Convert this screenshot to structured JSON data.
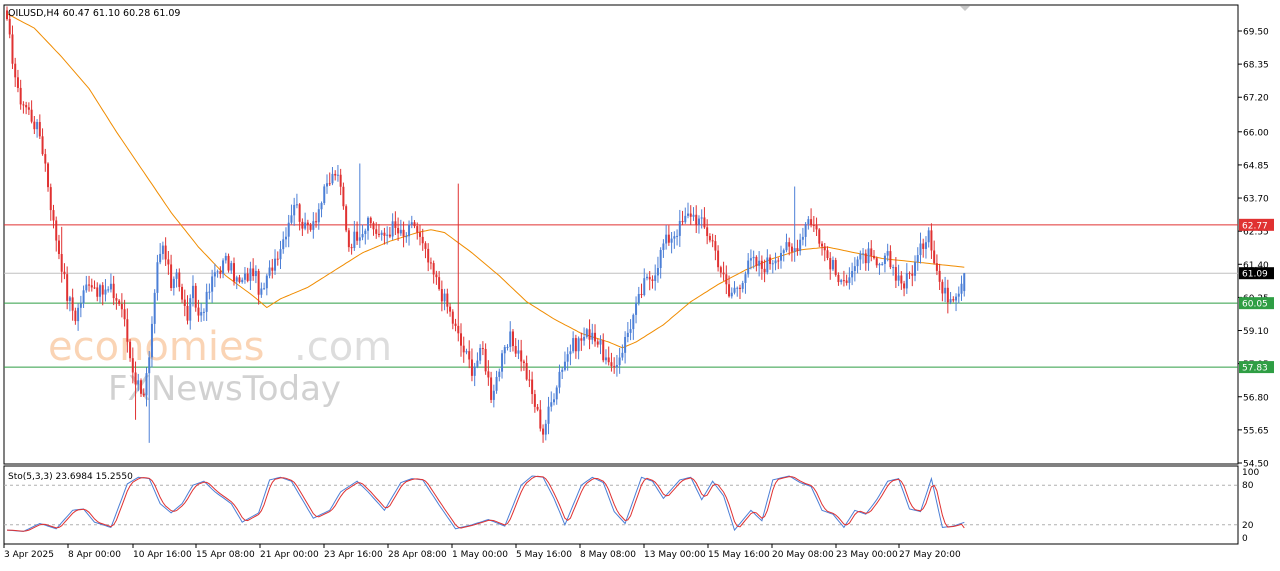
{
  "window": {
    "header_text": "OILUSD,H4  60.47 61.10 60.28 61.09"
  },
  "chart_data": {
    "type": "candlestick",
    "symbol": "OILUSD",
    "timeframe": "H4",
    "ohlc_header": {
      "open": 60.47,
      "high": 61.1,
      "low": 60.28,
      "close": 61.09
    },
    "ylim": [
      54.5,
      70.4
    ],
    "price_ticks": [
      "69.50",
      "68.35",
      "67.20",
      "66.00",
      "64.85",
      "63.70",
      "62.55",
      "61.40",
      "60.25",
      "59.10",
      "57.95",
      "56.80",
      "55.65",
      "54.50"
    ],
    "x_ticks": [
      "3 Apr 2025",
      "8 Apr 00:00",
      "10 Apr 16:00",
      "15 Apr 08:00",
      "21 Apr 00:00",
      "23 Apr 16:00",
      "28 Apr 08:00",
      "1 May 00:00",
      "5 May 16:00",
      "8 May 08:00",
      "13 May 00:00",
      "15 May 16:00",
      "20 May 08:00",
      "23 May 00:00",
      "27 May 20:00"
    ],
    "horizontal_levels": [
      {
        "label": "62.77",
        "value": 62.77,
        "color": "#e03131"
      },
      {
        "label": "60.05",
        "value": 60.05,
        "color": "#2f9e44"
      },
      {
        "label": "57.83",
        "value": 57.83,
        "color": "#2f9e44"
      }
    ],
    "current_price": {
      "label": "61.09",
      "value": 61.09
    },
    "ma_color": "#f08c00",
    "bull_color": "#4c7fd6",
    "bear_color": "#e03131",
    "close_anchors": [
      [
        0,
        69.7
      ],
      [
        2,
        68.6
      ],
      [
        4,
        67.3
      ],
      [
        8,
        66.7
      ],
      [
        12,
        65.9
      ],
      [
        14,
        64.9
      ],
      [
        17,
        62.8
      ],
      [
        20,
        61.4
      ],
      [
        22,
        60.3
      ],
      [
        25,
        59.6
      ],
      [
        30,
        60.9
      ],
      [
        34,
        60.4
      ],
      [
        38,
        60.5
      ],
      [
        42,
        59.9
      ],
      [
        45,
        58.2
      ],
      [
        47,
        57.4
      ],
      [
        50,
        57.0
      ],
      [
        52,
        58.0
      ],
      [
        55,
        61.3
      ],
      [
        57,
        62.0
      ],
      [
        60,
        60.7
      ],
      [
        62,
        61.3
      ],
      [
        64,
        60.1
      ],
      [
        66,
        59.6
      ],
      [
        68,
        60.4
      ],
      [
        70,
        59.6
      ],
      [
        73,
        60.2
      ],
      [
        76,
        61.1
      ],
      [
        80,
        61.5
      ],
      [
        85,
        60.7
      ],
      [
        90,
        61.2
      ],
      [
        93,
        60.3
      ],
      [
        97,
        61.4
      ],
      [
        101,
        62.3
      ],
      [
        105,
        63.6
      ],
      [
        109,
        62.6
      ],
      [
        113,
        63.1
      ],
      [
        117,
        64.1
      ],
      [
        120,
        64.6
      ],
      [
        122,
        64.0
      ],
      [
        125,
        62.1
      ],
      [
        129,
        62.6
      ],
      [
        133,
        62.8
      ],
      [
        137,
        62.3
      ],
      [
        141,
        62.7
      ],
      [
        145,
        62.3
      ],
      [
        149,
        62.8
      ],
      [
        152,
        62.0
      ],
      [
        155,
        61.2
      ],
      [
        158,
        60.6
      ],
      [
        162,
        59.7
      ],
      [
        166,
        58.6
      ],
      [
        170,
        57.8
      ],
      [
        174,
        58.4
      ],
      [
        177,
        56.9
      ],
      [
        180,
        57.8
      ],
      [
        184,
        58.8
      ],
      [
        188,
        58.2
      ],
      [
        191,
        57.2
      ],
      [
        194,
        56.2
      ],
      [
        196,
        55.6
      ],
      [
        199,
        56.6
      ],
      [
        202,
        57.7
      ],
      [
        206,
        58.5
      ],
      [
        210,
        58.8
      ],
      [
        214,
        59.1
      ],
      [
        218,
        58.3
      ],
      [
        221,
        57.6
      ],
      [
        225,
        58.5
      ],
      [
        229,
        59.6
      ],
      [
        233,
        60.7
      ],
      [
        237,
        61.2
      ],
      [
        240,
        62.1
      ],
      [
        244,
        62.5
      ],
      [
        246,
        62.7
      ],
      [
        250,
        63.2
      ],
      [
        254,
        62.8
      ],
      [
        258,
        62.2
      ],
      [
        261,
        61.2
      ],
      [
        264,
        60.3
      ],
      [
        268,
        60.8
      ],
      [
        272,
        61.5
      ],
      [
        276,
        61.3
      ],
      [
        280,
        61.6
      ],
      [
        284,
        62.0
      ],
      [
        287,
        61.8
      ],
      [
        290,
        62.3
      ],
      [
        293,
        63.1
      ],
      [
        296,
        62.6
      ],
      [
        298,
        62.0
      ],
      [
        302,
        61.3
      ],
      [
        305,
        60.6
      ],
      [
        308,
        61.2
      ],
      [
        311,
        61.5
      ],
      [
        315,
        61.7
      ],
      [
        318,
        61.2
      ],
      [
        322,
        61.6
      ],
      [
        325,
        61.1
      ],
      [
        328,
        60.7
      ],
      [
        332,
        61.4
      ],
      [
        335,
        62.1
      ],
      [
        337,
        62.7
      ],
      [
        339,
        61.6
      ],
      [
        342,
        60.4
      ],
      [
        345,
        60.3
      ],
      [
        348,
        60.6
      ],
      [
        350,
        61.09
      ]
    ],
    "ma_points": [
      [
        0,
        70.1
      ],
      [
        10,
        69.6
      ],
      [
        20,
        68.6
      ],
      [
        30,
        67.5
      ],
      [
        40,
        66.0
      ],
      [
        50,
        64.6
      ],
      [
        60,
        63.2
      ],
      [
        70,
        62.0
      ],
      [
        80,
        61.0
      ],
      [
        90,
        60.3
      ],
      [
        95,
        59.9
      ],
      [
        100,
        60.2
      ],
      [
        110,
        60.6
      ],
      [
        120,
        61.2
      ],
      [
        130,
        61.8
      ],
      [
        140,
        62.2
      ],
      [
        150,
        62.5
      ],
      [
        155,
        62.6
      ],
      [
        160,
        62.5
      ],
      [
        170,
        61.8
      ],
      [
        180,
        61.0
      ],
      [
        190,
        60.1
      ],
      [
        200,
        59.5
      ],
      [
        210,
        59.0
      ],
      [
        220,
        58.7
      ],
      [
        225,
        58.5
      ],
      [
        230,
        58.7
      ],
      [
        240,
        59.3
      ],
      [
        250,
        60.1
      ],
      [
        260,
        60.7
      ],
      [
        270,
        61.2
      ],
      [
        280,
        61.6
      ],
      [
        290,
        61.9
      ],
      [
        300,
        62.0
      ],
      [
        310,
        61.8
      ],
      [
        320,
        61.6
      ],
      [
        330,
        61.5
      ],
      [
        340,
        61.4
      ],
      [
        350,
        61.3
      ]
    ],
    "extremes": [
      [
        47,
        56.0
      ],
      [
        52,
        55.2
      ],
      [
        196,
        55.2
      ],
      [
        20,
        62.7
      ],
      [
        129,
        64.9
      ],
      [
        165,
        64.2
      ],
      [
        288,
        64.1
      ],
      [
        200,
        56.6
      ]
    ],
    "stochastic": {
      "label": "Sto(5,3,3) 23.6984 15.2550",
      "main": 23.6984,
      "signal": 15.255,
      "levels": [
        80,
        20
      ],
      "scale_labels": [
        "100",
        "80",
        "20",
        "0"
      ],
      "main_color": "#4c7fd6",
      "signal_color": "#e03131",
      "anchors": [
        [
          0,
          12
        ],
        [
          6,
          10
        ],
        [
          12,
          22
        ],
        [
          18,
          14
        ],
        [
          24,
          42
        ],
        [
          28,
          44
        ],
        [
          32,
          24
        ],
        [
          38,
          16
        ],
        [
          44,
          82
        ],
        [
          48,
          92
        ],
        [
          52,
          90
        ],
        [
          56,
          52
        ],
        [
          60,
          38
        ],
        [
          64,
          52
        ],
        [
          68,
          80
        ],
        [
          72,
          86
        ],
        [
          76,
          70
        ],
        [
          82,
          52
        ],
        [
          86,
          24
        ],
        [
          92,
          38
        ],
        [
          96,
          88
        ],
        [
          100,
          92
        ],
        [
          104,
          86
        ],
        [
          108,
          58
        ],
        [
          112,
          30
        ],
        [
          118,
          42
        ],
        [
          122,
          70
        ],
        [
          128,
          86
        ],
        [
          132,
          70
        ],
        [
          138,
          42
        ],
        [
          144,
          84
        ],
        [
          148,
          90
        ],
        [
          152,
          88
        ],
        [
          158,
          50
        ],
        [
          164,
          14
        ],
        [
          170,
          20
        ],
        [
          176,
          28
        ],
        [
          182,
          18
        ],
        [
          188,
          80
        ],
        [
          192,
          94
        ],
        [
          196,
          92
        ],
        [
          200,
          60
        ],
        [
          204,
          20
        ],
        [
          210,
          80
        ],
        [
          214,
          92
        ],
        [
          218,
          84
        ],
        [
          222,
          40
        ],
        [
          226,
          22
        ],
        [
          232,
          92
        ],
        [
          236,
          86
        ],
        [
          240,
          60
        ],
        [
          246,
          88
        ],
        [
          250,
          92
        ],
        [
          254,
          58
        ],
        [
          258,
          86
        ],
        [
          262,
          64
        ],
        [
          266,
          12
        ],
        [
          272,
          42
        ],
        [
          276,
          26
        ],
        [
          280,
          88
        ],
        [
          286,
          94
        ],
        [
          290,
          84
        ],
        [
          294,
          78
        ],
        [
          298,
          42
        ],
        [
          302,
          36
        ],
        [
          306,
          16
        ],
        [
          310,
          42
        ],
        [
          314,
          36
        ],
        [
          318,
          58
        ],
        [
          322,
          86
        ],
        [
          326,
          90
        ],
        [
          330,
          44
        ],
        [
          334,
          40
        ],
        [
          338,
          90
        ],
        [
          342,
          16
        ],
        [
          346,
          18
        ],
        [
          350,
          23.7
        ]
      ]
    }
  }
}
